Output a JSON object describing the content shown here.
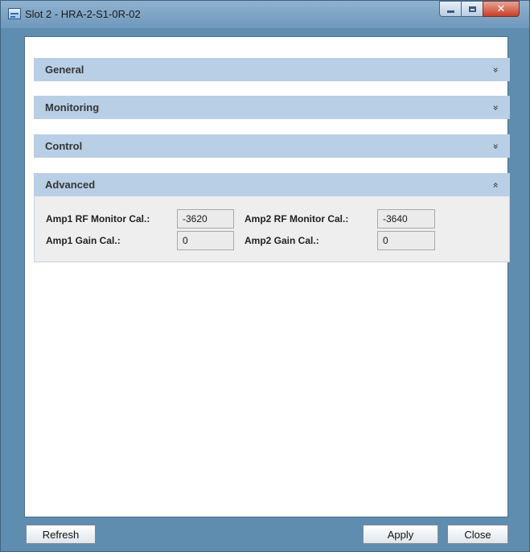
{
  "window": {
    "title": "Slot 2 - HRA-2-S1-0R-02",
    "icon": "app-icon",
    "controls": {
      "minimize_icon": "minimize-icon",
      "maximize_icon": "maximize-icon",
      "close_icon": "close-icon",
      "close_glyph": "✕"
    }
  },
  "sections": {
    "general": {
      "title": "General",
      "chevron": "»",
      "state": "collapsed"
    },
    "monitoring": {
      "title": "Monitoring",
      "chevron": "»",
      "state": "collapsed"
    },
    "control": {
      "title": "Control",
      "chevron": "»",
      "state": "collapsed"
    },
    "advanced": {
      "title": "Advanced",
      "chevron": "«",
      "state": "expanded"
    }
  },
  "advanced": {
    "amp1_rf_label": "Amp1 RF Monitor Cal.:",
    "amp1_rf_value": "-3620",
    "amp2_rf_label": "Amp2 RF Monitor Cal.:",
    "amp2_rf_value": "-3640",
    "amp1_gain_label": "Amp1 Gain Cal.:",
    "amp1_gain_value": "0",
    "amp2_gain_label": "Amp2 Gain Cal.:",
    "amp2_gain_value": "0"
  },
  "buttons": {
    "refresh": "Refresh",
    "apply": "Apply",
    "close": "Close"
  },
  "colors": {
    "window_frame": "#5f8db0",
    "section_header": "#b8cfe5",
    "panel_body": "#eeeeee",
    "close_button": "#c7402a"
  }
}
